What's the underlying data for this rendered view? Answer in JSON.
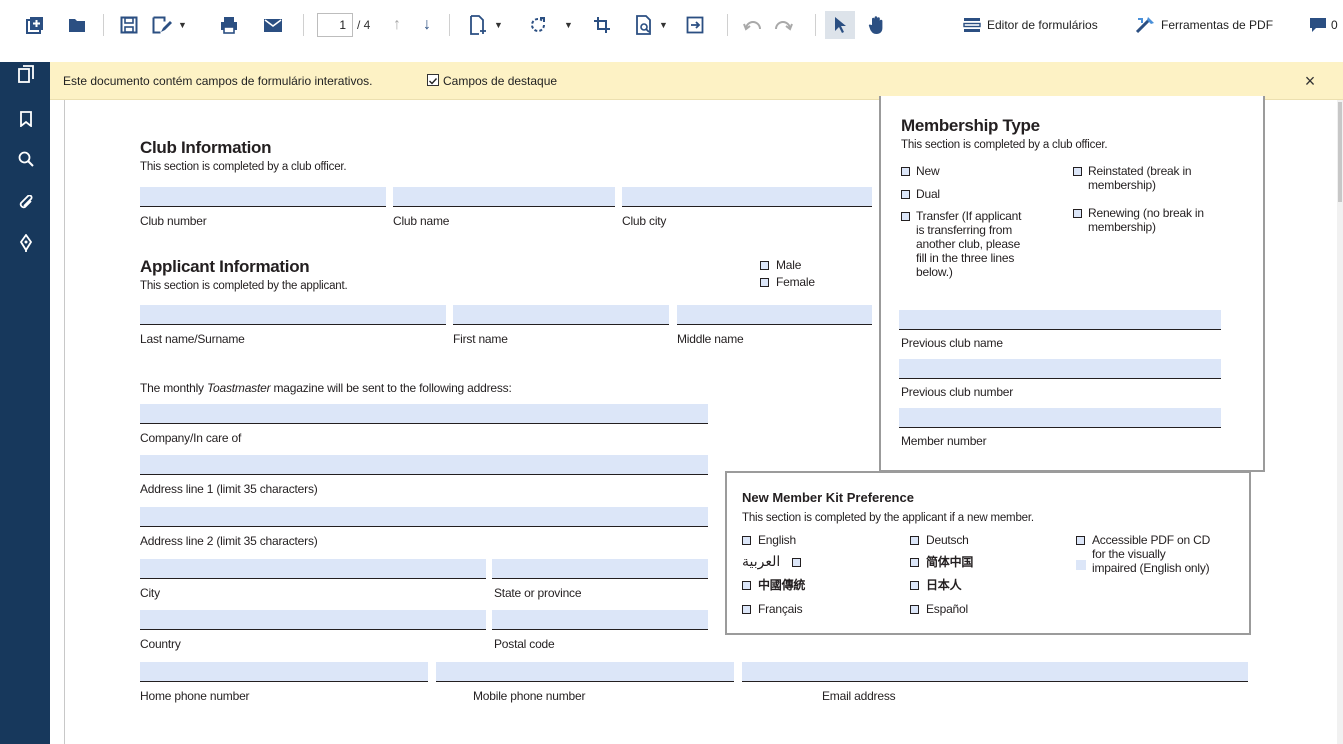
{
  "toolbar": {
    "page_current": "1",
    "page_total": "/ 4",
    "form_editor_label": "Editor de formulários",
    "pdf_tools_label": "Ferramentas de PDF",
    "comments_count": "0"
  },
  "notice": {
    "message": "Este documento contém campos de formulário interativos.",
    "highlight_label": "Campos de destaque",
    "highlight_checked": true,
    "close_symbol": "×"
  },
  "colors": {
    "sidebar": "#17385c",
    "notice_bg": "#fdf2c5",
    "field_fill": "#dce6f8",
    "icon_blue": "#2b4f82"
  },
  "club": {
    "title": "Club Information",
    "subtitle": "This section is completed by a club officer.",
    "labels": {
      "number": "Club number",
      "name": "Club name",
      "city": "Club city"
    }
  },
  "applicant": {
    "title": "Applicant Information",
    "subtitle": "This section is completed by the applicant.",
    "gender": {
      "male": "Male",
      "female": "Female"
    },
    "labels": {
      "last": "Last name/Surname",
      "first": "First name",
      "middle": "Middle name"
    }
  },
  "address": {
    "intro_before": "The monthly",
    "intro_italic": "Toastmaster",
    "intro_after": "magazine will be sent to the following address:",
    "labels": {
      "company": "Company/In care of",
      "line1": "Address line 1 (limit 35 characters)",
      "line2": "Address line 2 (limit 35 characters)",
      "city": "City",
      "state": "State or province",
      "country": "Country",
      "postal": "Postal code",
      "home_phone": "Home phone number",
      "mobile_phone": "Mobile phone number",
      "email": "Email address"
    }
  },
  "membership": {
    "title": "Membership Type",
    "subtitle": "This section is completed by a club officer.",
    "options": {
      "new": "New",
      "dual": "Dual",
      "transfer": [
        "Transfer (If applicant",
        "is transferring from",
        "another club, please",
        "fill in the three lines",
        "below.)"
      ],
      "reinstated": [
        "Reinstated (break in",
        "membership)"
      ],
      "renewing": [
        "Renewing (no break in",
        "membership)"
      ]
    },
    "labels": {
      "prev_name": "Previous club name",
      "prev_number": "Previous club number",
      "member_number": "Member number"
    }
  },
  "kit": {
    "title": "New Member Kit Preference",
    "subtitle": "This section is completed by the applicant if a new member.",
    "languages": {
      "english": "English",
      "arabic": "العربية",
      "chinese_traditional": "中國傳統",
      "french": "Français",
      "german": "Deutsch",
      "chinese_simplified": "简体中国",
      "japanese": "日本人",
      "spanish": "Español"
    },
    "accessible": [
      "Accessible PDF on CD",
      "for the visually",
      "impaired (English only)"
    ]
  }
}
